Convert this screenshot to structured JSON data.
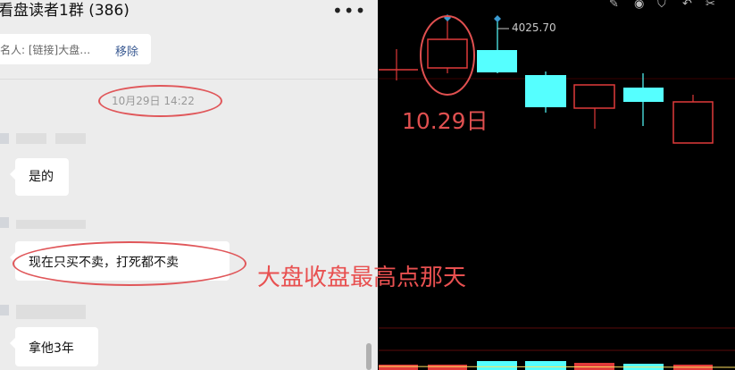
{
  "chat": {
    "title": "看盘读者1群 (386)",
    "more_glyph": "•••",
    "pinned_chip": {
      "text": "名人: [链接]大盘…",
      "remove_label": "移除"
    },
    "timestamp": "10月29日 14:22",
    "messages": [
      {
        "text": "是的"
      },
      {
        "text": "现在只买不卖，打死都不卖"
      },
      {
        "text": "拿他3年"
      }
    ]
  },
  "chart": {
    "colors": {
      "up": "#55ffff",
      "down": "#ff3333",
      "background": "#000000",
      "annotation": "#e05050"
    },
    "toolbar_icons": [
      "pen-icon",
      "eye-icon",
      "shield-icon",
      "undo-icon",
      "scissors-icon"
    ],
    "high_price_label": "4025.70",
    "date_annotation": "10.29日",
    "caption": "大盘收盘最高点那天",
    "candles": [
      {
        "color": "up",
        "note": "partial, left edge"
      },
      {
        "color": "down",
        "date": "10.29"
      },
      {
        "color": "up"
      },
      {
        "color": "up"
      },
      {
        "color": "down"
      },
      {
        "color": "up"
      },
      {
        "color": "down"
      }
    ]
  }
}
